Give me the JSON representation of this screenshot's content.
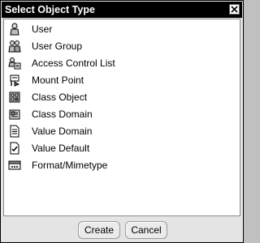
{
  "dialog": {
    "title": "Select Object Type"
  },
  "items": [
    {
      "label": "User",
      "icon": "user-icon"
    },
    {
      "label": "User Group",
      "icon": "user-group-icon"
    },
    {
      "label": "Access Control List",
      "icon": "access-control-list-icon"
    },
    {
      "label": "Mount Point",
      "icon": "mount-point-icon"
    },
    {
      "label": "Class Object",
      "icon": "class-object-icon"
    },
    {
      "label": "Class Domain",
      "icon": "class-domain-icon"
    },
    {
      "label": "Value Domain",
      "icon": "value-domain-icon"
    },
    {
      "label": "Value Default",
      "icon": "value-default-icon"
    },
    {
      "label": "Format/Mimetype",
      "icon": "format-mimetype-icon"
    }
  ],
  "buttons": {
    "create_label": "Create",
    "cancel_label": "Cancel"
  }
}
